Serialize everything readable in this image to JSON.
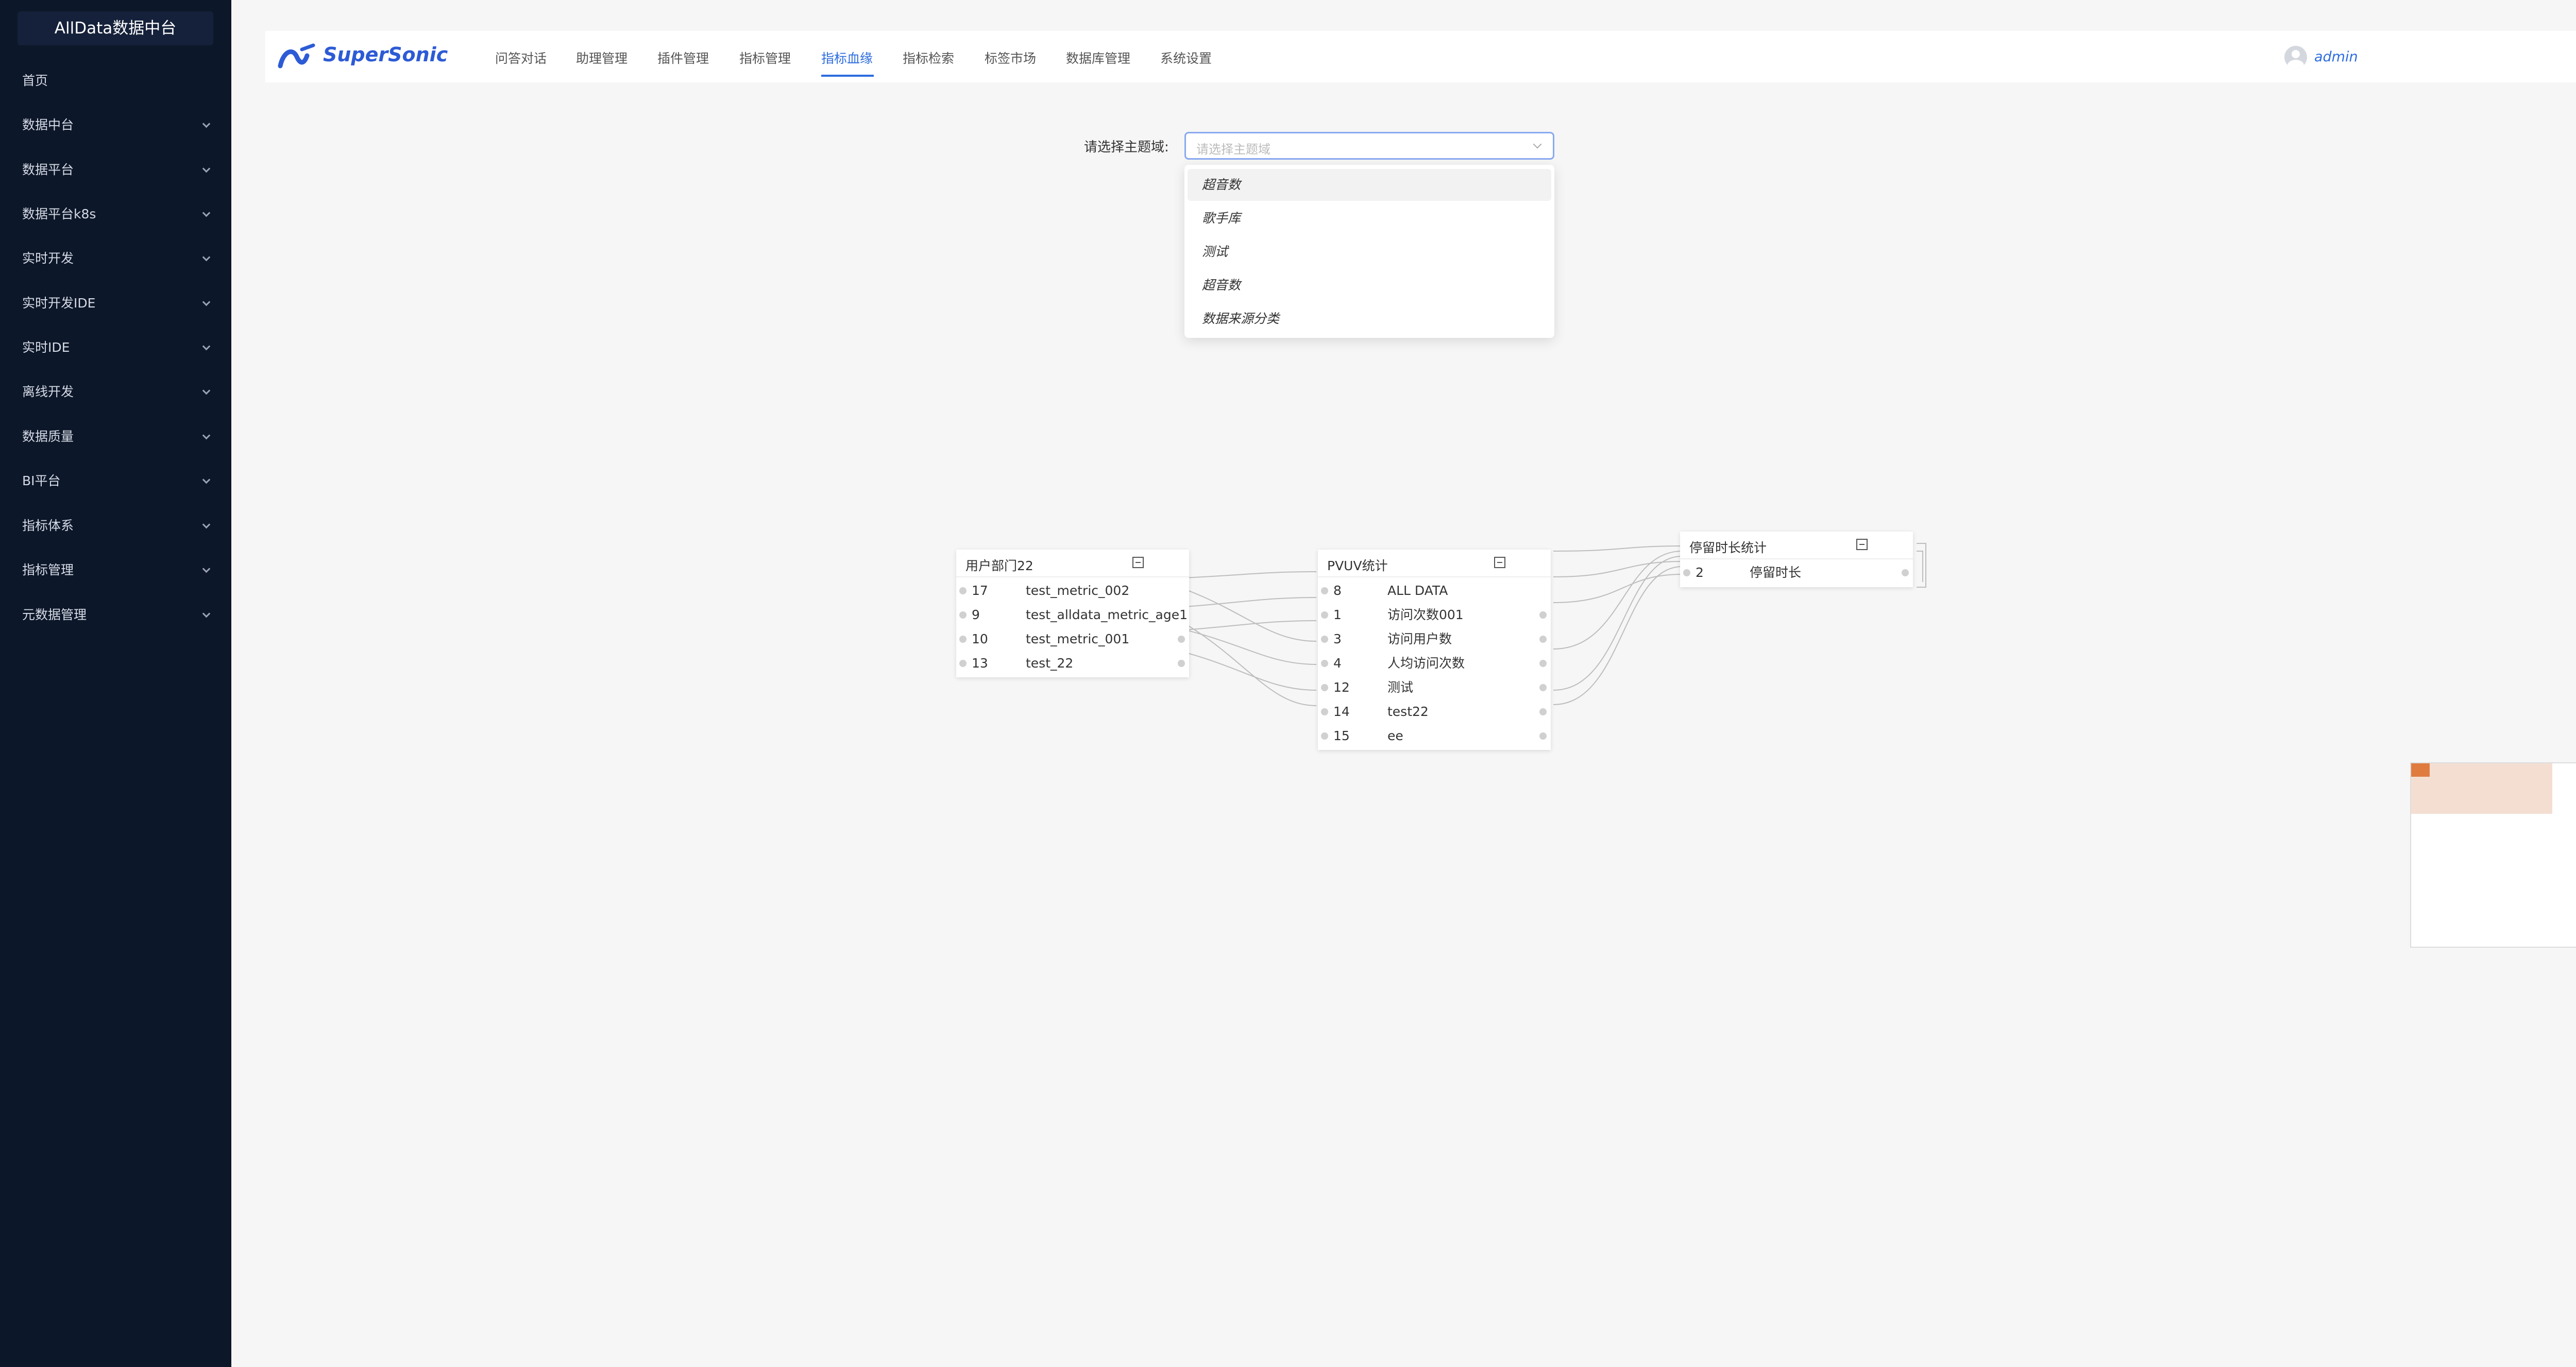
{
  "sidebar": {
    "brand": "AllData数据中台",
    "items": [
      {
        "label": "首页"
      },
      {
        "label": "数据中台"
      },
      {
        "label": "数据平台"
      },
      {
        "label": "数据平台k8s"
      },
      {
        "label": "实时开发"
      },
      {
        "label": "实时开发IDE"
      },
      {
        "label": "实时IDE"
      },
      {
        "label": "离线开发"
      },
      {
        "label": "数据质量"
      },
      {
        "label": "BI平台"
      },
      {
        "label": "指标体系"
      },
      {
        "label": "指标管理"
      },
      {
        "label": "元数据管理"
      }
    ]
  },
  "header": {
    "logo_text": "SuperSonic",
    "nav": [
      "问答对话",
      "助理管理",
      "插件管理",
      "指标管理",
      "指标血缘",
      "指标检索",
      "标签市场",
      "数据库管理",
      "系统设置"
    ],
    "active_index": 4,
    "user": "admin"
  },
  "filter": {
    "label": "请选择主题域:",
    "placeholder": "请选择主题域",
    "options": [
      "超音数",
      "歌手库",
      "测试",
      "超音数",
      "数据来源分类"
    ]
  },
  "graph": {
    "nodes": [
      {
        "title": "用户部门22",
        "rows": [
          {
            "id": "17",
            "name": "test_metric_002"
          },
          {
            "id": "9",
            "name": "test_alldata_metric_age1"
          },
          {
            "id": "10",
            "name": "test_metric_001"
          },
          {
            "id": "13",
            "name": "test_22"
          }
        ]
      },
      {
        "title": "PVUV统计",
        "rows": [
          {
            "id": "8",
            "name": "ALL DATA"
          },
          {
            "id": "1",
            "name": "访问次数001"
          },
          {
            "id": "3",
            "name": "访问用户数"
          },
          {
            "id": "4",
            "name": "人均访问次数"
          },
          {
            "id": "12",
            "name": "测试"
          },
          {
            "id": "14",
            "name": "test22"
          },
          {
            "id": "15",
            "name": "ee"
          }
        ]
      },
      {
        "title": "停留时长统计",
        "rows": [
          {
            "id": "2",
            "name": "停留时长"
          }
        ]
      }
    ]
  },
  "tools": [
    "fit-icon",
    "zoom-out-icon",
    "zoom-in-icon",
    "star-icon"
  ],
  "colors": {
    "sidebar": "#0c1729",
    "accent": "#2d6cdf",
    "bot": "#2d4fd6",
    "minimap_mark": "#e07b3f"
  }
}
